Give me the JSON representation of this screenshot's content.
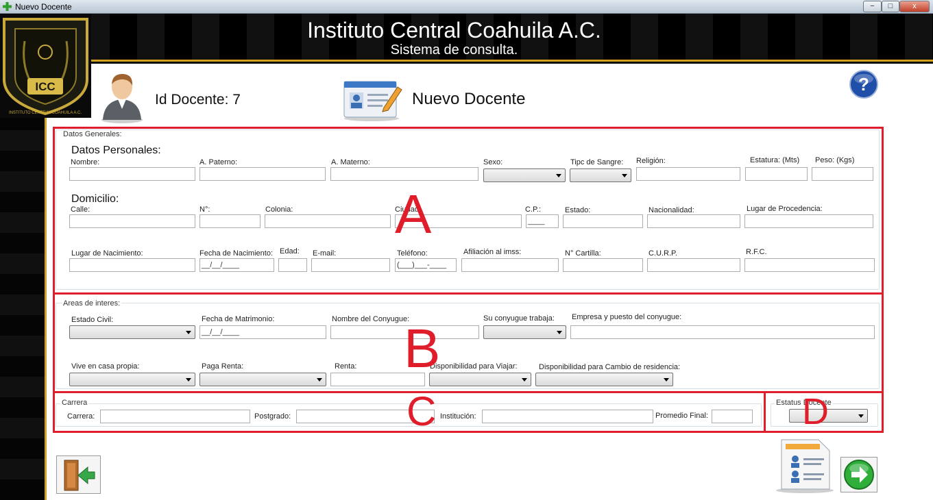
{
  "window": {
    "title": "Nuevo Docente",
    "min": "−",
    "max": "□",
    "close": "x"
  },
  "header": {
    "title": "Instituto Central Coahuila A.C.",
    "subtitle": "Sistema de consulta."
  },
  "logo": {
    "text": "ICC",
    "ring_text": "INSTITUTO CENTRAL COAHUILA A.C."
  },
  "info": {
    "id_label": "Id Docente: 7",
    "page_title": "Nuevo Docente"
  },
  "annotations": {
    "a": "A",
    "b": "B",
    "c": "C",
    "d": "D"
  },
  "colors": {
    "accent_gold": "#d3a21c",
    "annotation_red": "#e01d2a",
    "help_blue": "#1f4fa8",
    "next_green": "#2fae3a"
  },
  "datos_generales": {
    "group": "Datos Generales:",
    "personales": "Datos Personales:",
    "domicilio": "Domicilio:",
    "labels": {
      "nombre": "Nombre:",
      "paterno": "A. Paterno:",
      "materno": "A. Materno:",
      "sexo": "Sexo:",
      "sangre": "Tipc de Sangre:",
      "religion": "Religión:",
      "estatura": "Estatura: (Mts)",
      "peso": "Peso: (Kgs)",
      "calle": "Calle:",
      "numero": "N°:",
      "colonia": "Colonia:",
      "ciudad": "Ciudad:",
      "cp": "C.P.:",
      "estado": "Estado:",
      "nacionalidad": "Nacionalidad:",
      "procedencia": "Lugar de Procedencia:",
      "lugar_nac": "Lugar de Nacimiento:",
      "fecha_nac": "Fecha de Nacimiento:",
      "edad": "Edad:",
      "email": "E-mail:",
      "telefono": "Teléfono:",
      "imss": "Afiliación al imss:",
      "cartilla": "N° Cartilla:",
      "curp": "C.U.R.P.",
      "rfc": "R.F.C."
    },
    "masks": {
      "cp": "____",
      "fecha_nac": "__/__/____",
      "telefono": "(___)___-____"
    }
  },
  "areas": {
    "group": "Areas de interes:",
    "labels": {
      "estado_civil": "Estado Civil:",
      "fecha_mat": "Fecha de Matrimonio:",
      "conyuge": "Nombre del Conyugue:",
      "trabaja": "Su conyugue trabaja:",
      "empresa": "Empresa y puesto del conyugue:",
      "casa": "Vive en casa propia:",
      "paga_renta": "Paga Renta:",
      "renta": "Renta:",
      "viajar": "Disponibilidad para Viajar:",
      "residencia": "Disponibilidad para Cambio de residencia:"
    },
    "masks": {
      "fecha_mat": "__/__/____"
    }
  },
  "carrera": {
    "group": "Carrera",
    "labels": {
      "carrera": "Carrera:",
      "postgrado": "Postgrado:",
      "institucion": "Institución:",
      "promedio": "Promedio Final:"
    }
  },
  "estatus": {
    "group": "Estatus Docente"
  }
}
